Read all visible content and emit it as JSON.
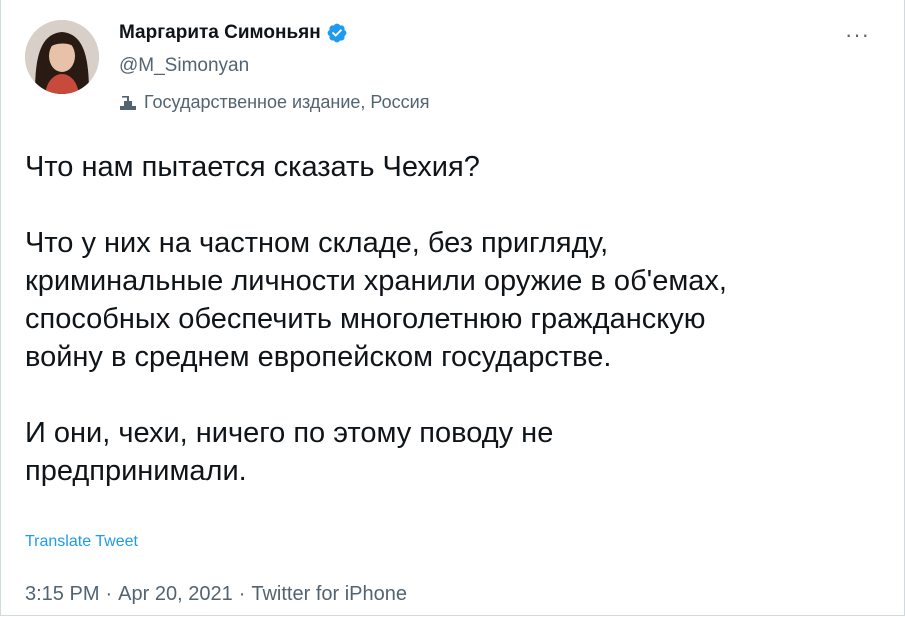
{
  "author": {
    "name": "Маргарита Симоньян",
    "handle": "@M_Simonyan",
    "label": "Государственное издание, Россия",
    "verified": true
  },
  "tweet": {
    "paragraphs": [
      [
        "Что нам пытается сказать Чехия?"
      ],
      [
        "Что у них на частном складе, без пригляду,",
        "криминальные личности хранили оружие в об'емах,",
        "способных обеспечить многолетнюю гражданскую",
        "войну в среднем европейском государстве."
      ],
      [
        "И они, чехи, ничего по этому поводу не",
        "предпринимали."
      ]
    ],
    "translate_label": "Translate Tweet",
    "time": "3:15 PM",
    "date": "Apr 20, 2021",
    "source": "Twitter for iPhone",
    "separator": "·"
  },
  "icons": {
    "more": "more-icon",
    "verified": "verified-badge-icon",
    "label": "government-podium-icon"
  },
  "colors": {
    "accent": "#1d9bf0",
    "secondary_text": "#536471",
    "primary_text": "#0f1419"
  }
}
